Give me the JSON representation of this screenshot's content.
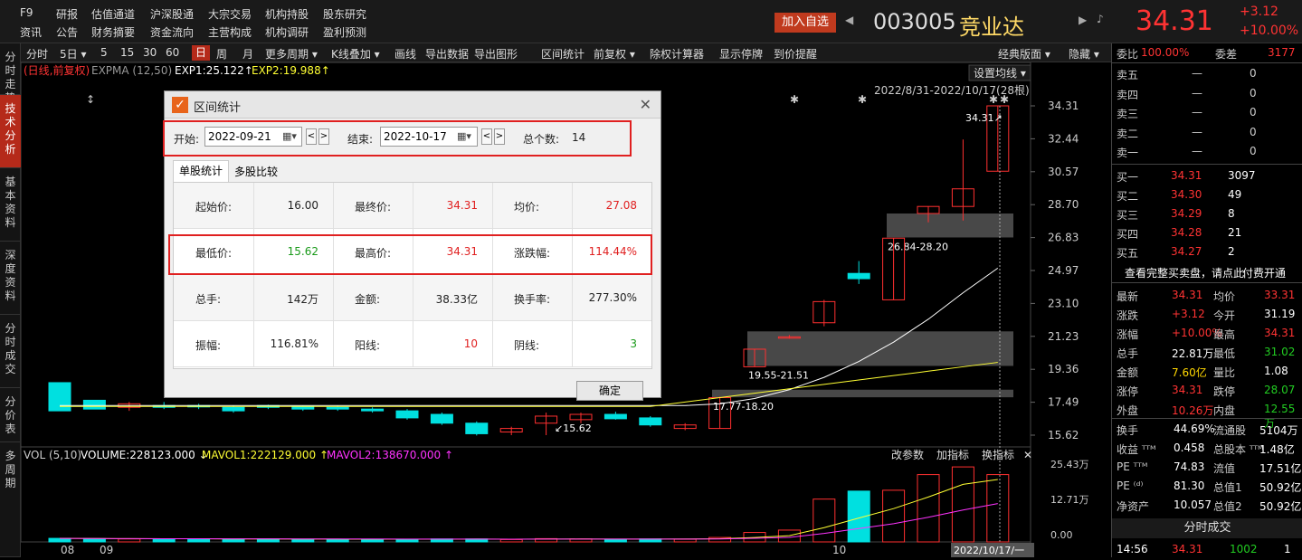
{
  "top": {
    "menus_row1": [
      "F9",
      "研报",
      "估值通道",
      "沪深股通",
      "大宗交易",
      "机构持股",
      "股东研究"
    ],
    "menus_row2": [
      "资讯",
      "公告",
      "财务摘要",
      "资金流向",
      "主营构成",
      "机构调研",
      "盈利预测"
    ],
    "add_btn": "加入自选",
    "code": "003005",
    "name": "竞业达",
    "price": "34.31",
    "change": "+3.12",
    "pct": "+10.00%"
  },
  "sidebar": [
    {
      "label": "分时走势",
      "on": false
    },
    {
      "label": "技术分析",
      "on": true
    },
    {
      "label": "基本资料",
      "on": false
    },
    {
      "label": "深度资料",
      "on": false
    },
    {
      "label": "分时成交",
      "on": false
    },
    {
      "label": "分价表",
      "on": false
    },
    {
      "label": "多周期",
      "on": false
    }
  ],
  "toolbar": [
    "分时",
    "5日 ▾",
    "5",
    "15",
    "30",
    "60",
    "日",
    "周",
    "月",
    "更多周期 ▾",
    "K线叠加 ▾",
    "画线",
    "导出数据",
    "导出图形",
    "区间统计",
    "前复权 ▾",
    "除权计算器",
    "显示停牌",
    "到价提醒"
  ],
  "toolbar_active": "日",
  "toolbar_right": [
    "经典版面 ▾",
    "隐藏 ▾"
  ],
  "chart": {
    "legend_mode": "(日线,前复权)",
    "legend_name": "EXPMA (12,50)",
    "exp1": "EXP1:25.122↑",
    "exp2": "EXP2:19.988↑",
    "set_ma": "设置均线 ▾",
    "range_label": "2022/8/31-2022/10/17(28根)",
    "high_label": "34.31",
    "low_label": "15.62",
    "zone_labels": [
      "26.84-28.20",
      "19.55-21.51",
      "17.77-18.20"
    ],
    "price_axis": [
      "34.31",
      "32.44",
      "30.57",
      "28.70",
      "26.83",
      "24.97",
      "23.10",
      "21.23",
      "19.36",
      "17.49",
      "15.62"
    ],
    "vol_legend": {
      "name": "VOL (5,10)",
      "vol": "VOLUME:228123.000 ↓",
      "ma1": "MAVOL1:222129.000 ↑",
      "ma2": "MAVOL2:138670.000 ↑"
    },
    "vol_btns": [
      "改参数",
      "加指标",
      "换指标",
      "✕"
    ],
    "vol_axis": [
      "25.43万",
      "12.71万",
      "0.00"
    ],
    "date_labels": [
      "08",
      "09",
      "10"
    ],
    "cursor_date": "2022/10/17/一",
    "candle_color_up": "#ff3030",
    "candle_color_down": "#00e0e0"
  },
  "dialog": {
    "title": "区间统计",
    "start_label": "开始:",
    "start_value": "2022-09-21",
    "end_label": "结束:",
    "end_value": "2022-10-17",
    "count_label": "总个数:",
    "count_value": "14",
    "tabs": [
      "单股统计",
      "多股比较"
    ],
    "rows": [
      [
        [
          "起始价:",
          "16.00",
          ""
        ],
        [
          "最终价:",
          "34.31",
          "red"
        ],
        [
          "均价:",
          "27.08",
          "red"
        ]
      ],
      [
        [
          "最低价:",
          "15.62",
          "green"
        ],
        [
          "最高价:",
          "34.31",
          "red"
        ],
        [
          "涨跌幅:",
          "114.44%",
          "red"
        ]
      ],
      [
        [
          "总手:",
          "142万",
          ""
        ],
        [
          "金额:",
          "38.33亿",
          ""
        ],
        [
          "换手率:",
          "277.30%",
          ""
        ]
      ],
      [
        [
          "振幅:",
          "116.81%",
          ""
        ],
        [
          "阳线:",
          "10",
          "red"
        ],
        [
          "阴线:",
          "3",
          "green"
        ]
      ]
    ],
    "ok": "确定"
  },
  "orderbook": {
    "ratio_label": "委比",
    "ratio": "100.00%",
    "diff_label": "委差",
    "diff": "3177",
    "sells": [
      [
        "卖五",
        "—",
        "0"
      ],
      [
        "卖四",
        "—",
        "0"
      ],
      [
        "卖三",
        "—",
        "0"
      ],
      [
        "卖二",
        "—",
        "0"
      ],
      [
        "卖一",
        "—",
        "0"
      ]
    ],
    "buys": [
      [
        "买一",
        "34.31",
        "3097"
      ],
      [
        "买二",
        "34.30",
        "49"
      ],
      [
        "买三",
        "34.29",
        "8"
      ],
      [
        "买四",
        "34.28",
        "21"
      ],
      [
        "买五",
        "34.27",
        "2"
      ]
    ],
    "note": "查看完整买卖盘，请点此",
    "pay": "付费开通",
    "stats": [
      [
        "最新",
        "34.31",
        "red",
        "均价",
        "33.31",
        "red"
      ],
      [
        "涨跌",
        "+3.12",
        "red",
        "今开",
        "31.19",
        "white"
      ],
      [
        "涨幅",
        "+10.00%",
        "red",
        "最高",
        "34.31",
        "red"
      ],
      [
        "总手",
        "22.81万",
        "white",
        "最低",
        "31.02",
        "green"
      ],
      [
        "金额",
        "7.60亿",
        "yellow",
        "量比",
        "1.08",
        "white"
      ],
      [
        "涨停",
        "34.31",
        "red",
        "跌停",
        "28.07",
        "green"
      ],
      [
        "外盘",
        "10.26万",
        "red",
        "内盘",
        "12.55万",
        "green"
      ]
    ],
    "stats2": [
      [
        "换手",
        "44.69%",
        "流通股",
        "5104万"
      ],
      [
        "收益 ᵀᵀᴹ",
        "0.458",
        "总股本 ᵀᵀᴹ",
        "1.48亿"
      ],
      [
        "PE ᵀᵀᴹ",
        "74.83",
        "流值",
        "17.51亿"
      ],
      [
        "PE ⁽ᵈ⁾",
        "81.30",
        "总值1",
        "50.92亿"
      ],
      [
        "净资产",
        "10.057",
        "总值2",
        "50.92亿"
      ]
    ],
    "trade_title": "分时成交",
    "trade": [
      "14:56",
      "34.31",
      "1002",
      "1"
    ]
  }
}
